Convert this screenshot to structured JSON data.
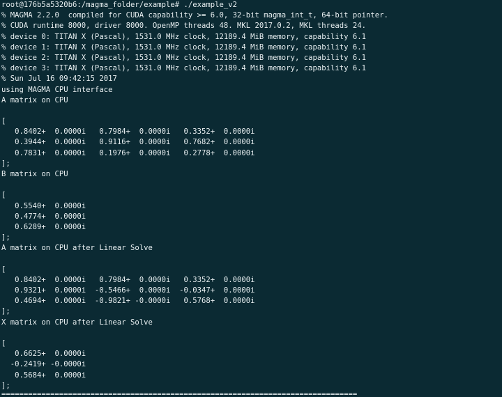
{
  "terminal": {
    "lines": [
      "root@176b5a5320b6:/magma_folder/example# ./example_v2",
      "% MAGMA 2.2.0  compiled for CUDA capability >= 6.0, 32-bit magma_int_t, 64-bit pointer.",
      "% CUDA runtime 8000, driver 8000. OpenMP threads 48. MKL 2017.0.2, MKL threads 24.",
      "% device 0: TITAN X (Pascal), 1531.0 MHz clock, 12189.4 MiB memory, capability 6.1",
      "% device 1: TITAN X (Pascal), 1531.0 MHz clock, 12189.4 MiB memory, capability 6.1",
      "% device 2: TITAN X (Pascal), 1531.0 MHz clock, 12189.4 MiB memory, capability 6.1",
      "% device 3: TITAN X (Pascal), 1531.0 MHz clock, 12189.4 MiB memory, capability 6.1",
      "% Sun Jul 16 09:42:15 2017",
      "using MAGMA CPU interface",
      "A matrix on CPU",
      "",
      "[",
      "   0.8402+  0.0000i   0.7984+  0.0000i   0.3352+  0.0000i",
      "   0.3944+  0.0000i   0.9116+  0.0000i   0.7682+  0.0000i",
      "   0.7831+  0.0000i   0.1976+  0.0000i   0.2778+  0.0000i",
      "];",
      "B matrix on CPU",
      "",
      "[",
      "   0.5540+  0.0000i",
      "   0.4774+  0.0000i",
      "   0.6289+  0.0000i",
      "];",
      "A matrix on CPU after Linear Solve",
      "",
      "[",
      "   0.8402+  0.0000i   0.7984+  0.0000i   0.3352+  0.0000i",
      "   0.9321+  0.0000i  -0.5466+  0.0000i  -0.0347+  0.0000i",
      "   0.4694+  0.0000i  -0.9821+ -0.0000i   0.5768+  0.0000i",
      "];",
      "X matrix on CPU after Linear Solve",
      "",
      "[",
      "   0.6625+  0.0000i",
      "  -0.2419+ -0.0000i",
      "   0.5684+  0.0000i",
      "];"
    ],
    "rule": "================================================================================"
  },
  "colors": {
    "background": "#0b2a33",
    "foreground": "#e7eef0"
  }
}
